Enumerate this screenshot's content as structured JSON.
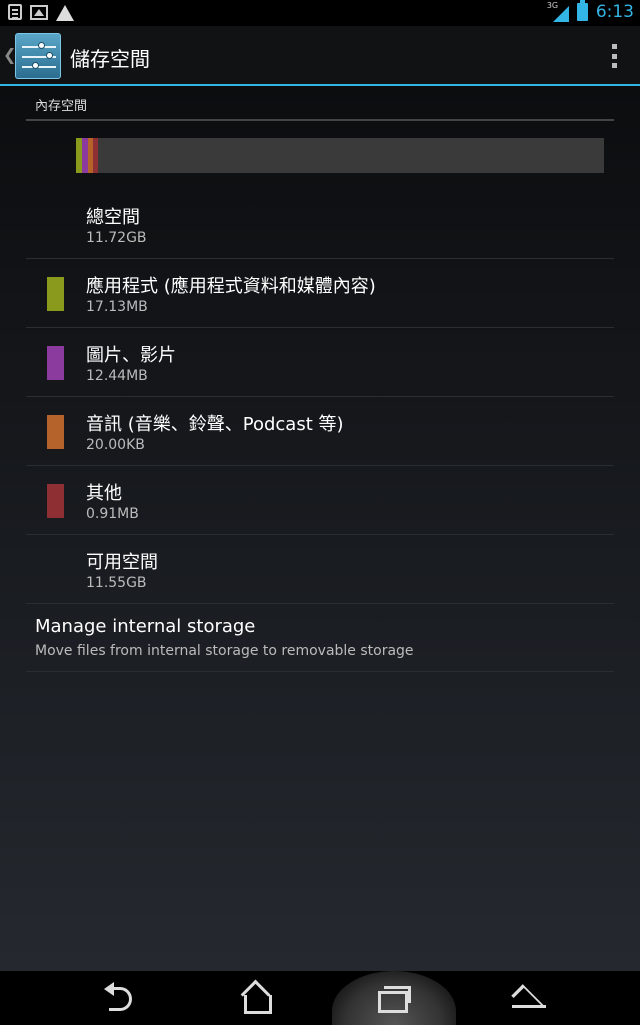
{
  "statusbar": {
    "left_icons": [
      "battery-note-icon",
      "image-icon",
      "warning-icon"
    ],
    "network": "3G",
    "time": "6:13",
    "accent": "#33b5e5"
  },
  "actionbar": {
    "title": "儲存空間",
    "icon": "settings-sliders-icon"
  },
  "section_header": "內存空間",
  "usage_bar": {
    "segments": [
      {
        "name": "apps",
        "color": "#8a9a1c",
        "fraction": 0.012
      },
      {
        "name": "pictures",
        "color": "#8b3a9e",
        "fraction": 0.01
      },
      {
        "name": "audio",
        "color": "#b5632a",
        "fraction": 0.01
      },
      {
        "name": "misc",
        "color": "#8e2f33",
        "fraction": 0.01
      }
    ],
    "free_color": "#3a3a3a"
  },
  "rows": [
    {
      "label": "總空間",
      "value": "11.72GB",
      "color": null
    },
    {
      "label": "應用程式 (應用程式資料和媒體內容)",
      "value": "17.13MB",
      "color": "#8a9a1c"
    },
    {
      "label": "圖片、影片",
      "value": "12.44MB",
      "color": "#8b3a9e"
    },
    {
      "label": "音訊 (音樂、鈴聲、Podcast 等)",
      "value": "20.00KB",
      "color": "#b5632a"
    },
    {
      "label": "其他",
      "value": "0.91MB",
      "color": "#8e2f33"
    },
    {
      "label": "可用空間",
      "value": "11.55GB",
      "color": null
    }
  ],
  "manage": {
    "title": "Manage internal storage",
    "summary": "Move files from internal storage to removable storage"
  },
  "navbar": {
    "buttons": [
      "back-icon",
      "home-icon",
      "recents-icon",
      "menu-icon"
    ]
  }
}
